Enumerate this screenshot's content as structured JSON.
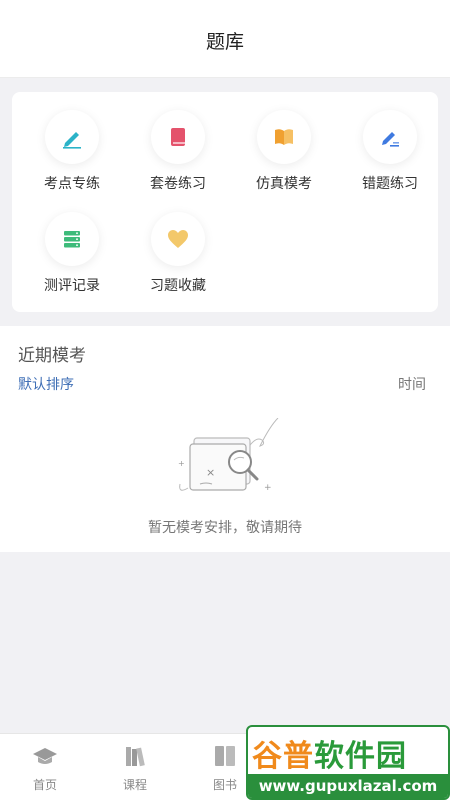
{
  "header": {
    "title": "题库"
  },
  "grid": {
    "items": [
      {
        "label": "考点专练",
        "icon": "pen-icon",
        "color": "#2bb3c8"
      },
      {
        "label": "套卷练习",
        "icon": "book-icon",
        "color": "#e4536c"
      },
      {
        "label": "仿真模考",
        "icon": "open-book-icon",
        "color": "#f0a030"
      },
      {
        "label": "错题练习",
        "icon": "edit-icon",
        "color": "#3f7ae0"
      },
      {
        "label": "测评记录",
        "icon": "stack-icon",
        "color": "#3dbb7a"
      },
      {
        "label": "习题收藏",
        "icon": "heart-icon",
        "color": "#f3c86a"
      }
    ]
  },
  "recent": {
    "title": "近期模考",
    "sort_label": "默认排序",
    "time_label": "时间",
    "empty_text": "暂无模考安排，敬请期待"
  },
  "tabbar": {
    "items": [
      {
        "label": "首页",
        "icon": "graduation-cap-icon"
      },
      {
        "label": "课程",
        "icon": "books-icon"
      },
      {
        "label": "图书",
        "icon": "book-spines-icon"
      }
    ]
  },
  "watermark": {
    "top": "谷普软件园",
    "top_a": "谷普",
    "top_b": "软件园",
    "bottom": "www.gupuxlazal.com"
  }
}
